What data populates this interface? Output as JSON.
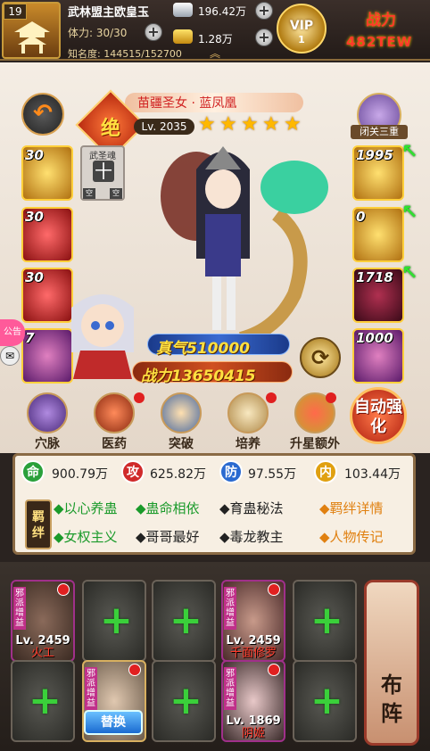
{
  "player": {
    "level": "19",
    "name": "武林盟主欧皇玉",
    "stamina": "体力: 30/30",
    "fame": "知名度: 144515/152700",
    "silver": "196.42万",
    "gold": "1.28万",
    "vip_label": "VIP",
    "vip_level": "1",
    "power_label": "战力",
    "power_value": "482TEW"
  },
  "hero": {
    "name": "苗疆圣女 · 蓝凤凰",
    "rank": "绝",
    "level": "Lv. 2035",
    "stars": 5,
    "seclusion": "闭关三重",
    "soul_label": "武圣魂",
    "empty_tag": "空",
    "chi": "真气510000",
    "fight_power": "战力13650415"
  },
  "equip_left": [
    {
      "num": "30",
      "style": "eq-gold",
      "name": "equip-slot-1"
    },
    {
      "num": "30",
      "style": "eq-red",
      "name": "equip-slot-2"
    },
    {
      "num": "30",
      "style": "eq-red",
      "name": "equip-slot-3"
    },
    {
      "num": "7",
      "style": "eq-purple",
      "name": "equip-slot-4"
    }
  ],
  "equip_right": [
    {
      "num": "1995",
      "style": "eq-gold",
      "name": "equip-slot-5"
    },
    {
      "num": "0",
      "style": "eq-gold",
      "name": "equip-slot-6"
    },
    {
      "num": "1718",
      "style": "eq-darkred",
      "name": "equip-slot-7"
    },
    {
      "num": "1000",
      "style": "eq-purple",
      "name": "equip-slot-8"
    }
  ],
  "notice": "公告",
  "functions": [
    "穴脉",
    "医药",
    "突破",
    "培养",
    "升星额外"
  ],
  "auto_btn": "自动强化",
  "stats": [
    {
      "icon": "命",
      "value": "900.79万",
      "color": "#2aa03a"
    },
    {
      "icon": "攻",
      "value": "625.82万",
      "color": "#d02a2a"
    },
    {
      "icon": "防",
      "value": "97.55万",
      "color": "#2a6ad0"
    },
    {
      "icon": "内",
      "value": "103.44万",
      "color": "#e0a010"
    }
  ],
  "bond_tag": "羁绊",
  "bonds_row1": [
    {
      "text": "◆以心养蛊",
      "on": true
    },
    {
      "text": "◆蛊命相依",
      "on": true
    },
    {
      "text": "◆育蛊秘法",
      "on": false
    }
  ],
  "bonds_row2": [
    {
      "text": "◆女权主义",
      "on": true
    },
    {
      "text": "◆哥哥最好",
      "on": false
    },
    {
      "text": "◆毒龙教主",
      "on": false
    }
  ],
  "links": {
    "bond_detail": "◆羁绊详情",
    "bio": "◆人物传记"
  },
  "lineup": {
    "cross": "+",
    "sect_tag": "邪派增益",
    "replace": "替换",
    "formation": "布阵",
    "heroes": [
      {
        "lv": "Lv. 2459",
        "nm": "火工"
      },
      {
        "lv": "Lv. 2459",
        "nm": "千面修罗"
      },
      {
        "lv": "Lv. 1869",
        "nm": "阴姬"
      }
    ]
  }
}
